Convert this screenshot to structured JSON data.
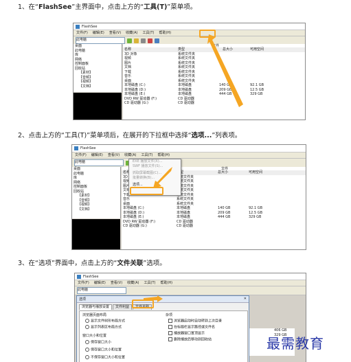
{
  "steps": [
    {
      "num": "1、",
      "pre": "在“",
      "b1": "FlashSee",
      "mid": "”主界面中，点击上方的“",
      "b2": "工具(T)",
      "post": "”菜单项。"
    },
    {
      "num": "2、",
      "pre": "点击上方的“工具(T)”菜单项后，在展开的下拉框中选择“",
      "b1": "选项...",
      "post": "”列表项。"
    },
    {
      "num": "3、",
      "pre": "在“选项”界面中，点击上方的“",
      "b1": "文件关联",
      "post": "”选项。"
    }
  ],
  "app": {
    "title": "FlashSee",
    "menu": [
      "文件(F)",
      "编辑(E)",
      "查看(V)",
      "收藏(A)",
      "工具(T)",
      "帮助(H)"
    ],
    "address": "此电脑",
    "tree": [
      "桌面",
      "此电脑",
      "库",
      "网络",
      "控制面板",
      "回收站",
      "【素材】",
      "【音频】",
      "【视频】",
      "【文档】"
    ],
    "list_header": {
      "group": "文件",
      "name": "名称",
      "type": "类型",
      "size": "总大小",
      "free": "可用空间"
    },
    "list_rows": [
      {
        "name": "3D 对象",
        "type": "系统文件夹",
        "size": "",
        "free": ""
      },
      {
        "name": "视频",
        "type": "系统文件夹",
        "size": "",
        "free": ""
      },
      {
        "name": "图片",
        "type": "系统文件夹",
        "size": "",
        "free": ""
      },
      {
        "name": "文档",
        "type": "系统文件夹",
        "size": "",
        "free": ""
      },
      {
        "name": "下载",
        "type": "系统文件夹",
        "size": "",
        "free": ""
      },
      {
        "name": "音乐",
        "type": "系统文件夹",
        "size": "",
        "free": ""
      },
      {
        "name": "桌面",
        "type": "系统文件夹",
        "size": "",
        "free": ""
      },
      {
        "name": "本地磁盘 (C:)",
        "type": "本地磁盘",
        "size": "140 GB",
        "free": "92.1 GB"
      },
      {
        "name": "本地磁盘 (D:)",
        "type": "本地磁盘",
        "size": "209 GB",
        "free": "12.5 GB"
      },
      {
        "name": "本地磁盘 (E:)",
        "type": "本地磁盘",
        "size": "444 GB",
        "free": "329 GB"
      },
      {
        "name": "DVD RW 驱动器 (F:)",
        "type": "CD 驱动器",
        "size": "",
        "free": ""
      },
      {
        "name": "CD 驱动器 (G:)",
        "type": "CD 驱动器",
        "size": "",
        "free": ""
      }
    ],
    "tools_menu": [
      "EXE 播放文件(X)...",
      "SWF 播放文件(S)...",
      "抓取屏幕截图(C)...",
      "批量转换(B)...",
      "选项..."
    ]
  },
  "dialog": {
    "title": "选项",
    "tabs": [
      "浏览器与播放设置",
      "文件利益",
      "文件关联"
    ],
    "group1_title": "浏览器页面布局",
    "group1_opts": [
      "显示文件树形布局方式",
      "显示列表区布局方式"
    ],
    "group2_title": "窗口大小和位置",
    "group2_opts": [
      "保存窗口大小",
      "保存窗口大小和位置",
      "不保存窗口大小和位置"
    ],
    "group3_title": "杂项",
    "group3_opts": [
      "浏览器启动时自动转到上次目录",
      "在标题栏显示路径或文件名",
      "播放器窗口置顶显示",
      "删除播放后移动到回收站"
    ],
    "list_tail": [
      "406 GB",
      "329 GB"
    ]
  },
  "watermark": "最需教育",
  "colors": {
    "highlight": "#f5a623",
    "watermark": "#2b3aa8"
  }
}
